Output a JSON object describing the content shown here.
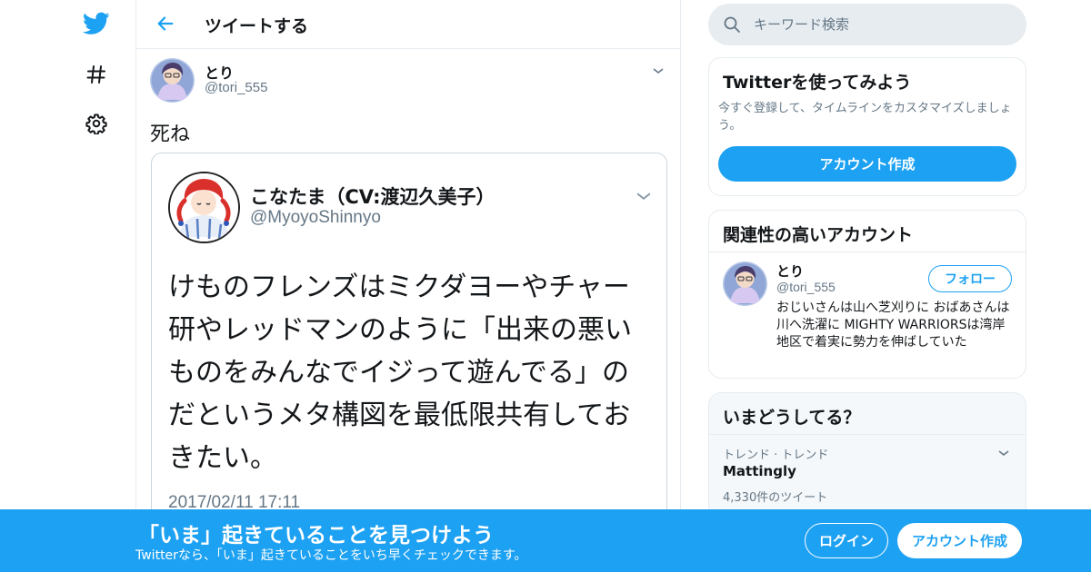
{
  "colors": {
    "accent": "#1da1f2",
    "secondary_text": "#657786",
    "border": "#e6ecf0"
  },
  "nav": {
    "icons": [
      "twitter-bird-icon",
      "hashtag-icon",
      "gear-icon"
    ]
  },
  "header": {
    "title": "ツイートする"
  },
  "tweet": {
    "name": "とり",
    "handle": "@tori_555",
    "text": "死ね",
    "embedded": {
      "name": "こなたま（CV:渡辺久美子）",
      "handle": "@MyoyoShinnyo",
      "text": "けものフレンズはミクダヨーやチャー研やレッドマンのように「出来の悪いものをみんなでイジって遊んでる」のだというメタ構図を最低限共有しておきたい。",
      "date": "2017/02/11 17:11"
    }
  },
  "search": {
    "placeholder": "キーワード検索"
  },
  "signup_card": {
    "title": "Twitterを使ってみよう",
    "description": "今すぐ登録して、タイムラインをカスタマイズしましょう。",
    "button": "アカウント作成"
  },
  "related_card": {
    "title": "関連性の高いアカウント",
    "account": {
      "name": "とり",
      "handle": "@tori_555",
      "follow": "フォロー",
      "bio": "おじいさんは山へ芝刈りに おばあさんは川へ洗濯に MIGHTY WARRIORSは湾岸地区で着実に勢力を伸ばしていた"
    }
  },
  "trends_card": {
    "title": "いまどうしてる？",
    "trend": {
      "context": "トレンド · トレンド",
      "name": "Mattingly",
      "count": "4,330件のツイート"
    }
  },
  "banner": {
    "title": "「いま」起きていることを見つけよう",
    "subtitle": "Twitterなら、「いま」起きていることをいち早くチェックできます。",
    "login": "ログイン",
    "signup": "アカウント作成"
  }
}
